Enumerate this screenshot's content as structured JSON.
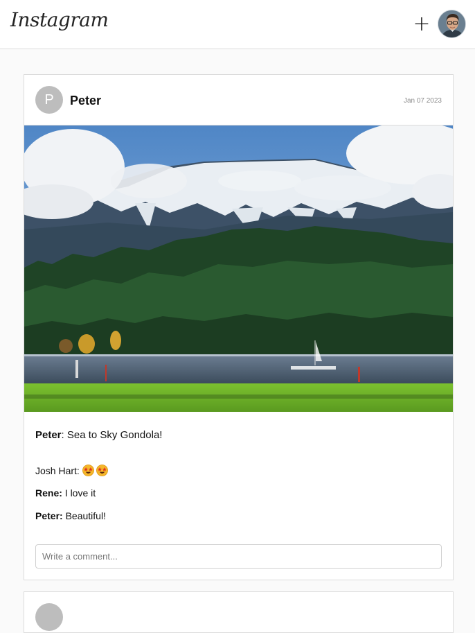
{
  "header": {
    "logo_text": "Instagram",
    "add_label": "+"
  },
  "post": {
    "author_initial": "P",
    "author_name": "Peter",
    "date": "Jan 07 2023",
    "image_description_icon": "landscape-photo",
    "caption_author": "Peter",
    "caption_text": "Sea to Sky Gondola!",
    "comments": [
      {
        "author": "Josh Hart:",
        "text": "",
        "emoji": [
          "star-struck-emoji",
          "star-struck-emoji"
        ]
      },
      {
        "author": "Rene:",
        "text": "I love it"
      },
      {
        "author": "Peter:",
        "text": "Beautiful!"
      }
    ],
    "comment_placeholder": "Write a comment..."
  },
  "colors": {
    "background": "#fafafa",
    "card": "#ffffff",
    "border": "#dbdbdb",
    "avatar_placeholder": "#bdbdbd",
    "muted_text": "#8e8e8e"
  }
}
